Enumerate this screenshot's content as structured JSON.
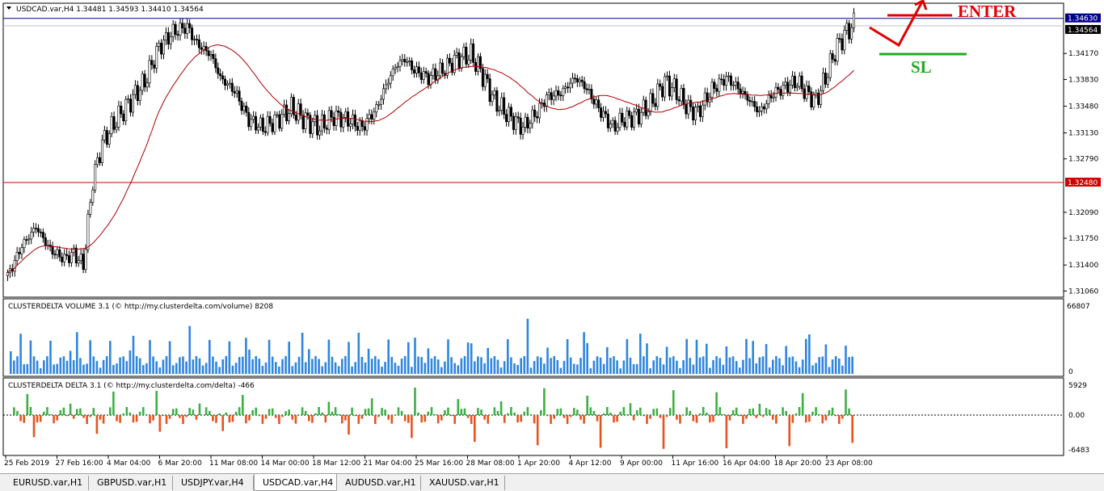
{
  "price_pane": {
    "title": "USDCAD.var,H4  1.34481 1.34593 1.34410 1.34564",
    "y_ticks": [
      "1.34170",
      "1.33830",
      "1.33480",
      "1.33130",
      "1.32790",
      "1.32090",
      "1.31750",
      "1.31400",
      "1.31060"
    ],
    "y_tick_values": [
      1.3417,
      1.3383,
      1.3348,
      1.3313,
      1.3279,
      1.3209,
      1.3175,
      1.314,
      1.3106
    ],
    "ylim": [
      1.31,
      1.3468
    ],
    "tag_high": "1.34630",
    "tag_current": "1.34564",
    "tag_low": "1.32480",
    "level_high": 1.3463,
    "level_current": 1.34564,
    "level_low": 1.3248,
    "annotation_enter": "ENTER",
    "annotation_sl": "SL",
    "colors": {
      "high_line": "#00008b",
      "low_line": "#d00000",
      "ma": "#b00000",
      "candle": "#000000",
      "enter": "#e00000",
      "sl": "#22aa22"
    }
  },
  "volume_pane": {
    "title": "CLUSTERDELTA VOLUME 3.1 (© http://my.clusterdelta.com/volume) 8208",
    "max_label": "66807",
    "zero_label": "0",
    "max_value": 66807,
    "color": "#2e86de"
  },
  "delta_pane": {
    "title": "CLUSTERDELTA DELTA 3.1 (© http://my.clusterdelta.com/delta) -466",
    "top_label": "5929",
    "zero_label": "0.00",
    "bottom_label": "-6483",
    "max_value": 5929,
    "min_value": -6483,
    "pos_color": "#3cb043",
    "neg_color": "#e8531c"
  },
  "x_axis": {
    "labels": [
      "25 Feb 2019",
      "27 Feb 16:00",
      "4 Mar 04:00",
      "6 Mar 20:00",
      "11 Mar 08:00",
      "14 Mar 00:00",
      "18 Mar 12:00",
      "21 Mar 04:00",
      "25 Mar 16:00",
      "28 Mar 08:00",
      "1 Apr 20:00",
      "4 Apr 12:00",
      "9 Apr 00:00",
      "11 Apr 16:00",
      "16 Apr 04:00",
      "18 Apr 20:00",
      "23 Apr 08:00"
    ]
  },
  "tabs": [
    {
      "label": "EURUSD.var,H1",
      "active": false
    },
    {
      "label": "GBPUSD.var,H1",
      "active": false
    },
    {
      "label": "USDJPY.var,H4",
      "active": false
    },
    {
      "label": "USDCAD.var,H4",
      "active": true
    },
    {
      "label": "AUDUSD.var,H1",
      "active": false
    },
    {
      "label": "XAUUSD.var,H1",
      "active": false
    }
  ]
}
